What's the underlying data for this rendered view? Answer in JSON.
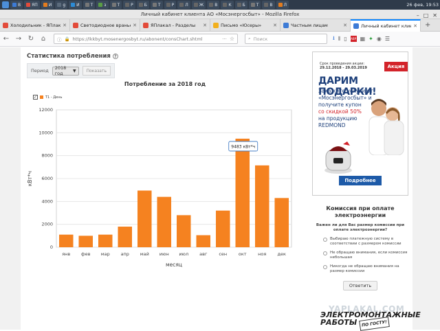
{
  "desktop": {
    "clock": "26 фев, 19:53",
    "tasks": [
      {
        "label": "В",
        "color": "#3d7bd6"
      },
      {
        "label": "ЯП",
        "color": "#e34b3a"
      },
      {
        "label": "И",
        "color": "#e37c1e"
      },
      {
        "label": "g",
        "color": "#5b6b7c"
      },
      {
        "label": "И",
        "color": "#2c8bd6"
      },
      {
        "label": "Т",
        "color": "#777777"
      },
      {
        "label": "з",
        "color": "#5a9d44"
      },
      {
        "label": "Т",
        "color": "#777777"
      },
      {
        "label": "Р",
        "color": "#666666"
      },
      {
        "label": "Б",
        "color": "#666666"
      },
      {
        "label": "Т",
        "color": "#777777"
      },
      {
        "label": "Р",
        "color": "#666666"
      },
      {
        "label": "Л",
        "color": "#666666"
      },
      {
        "label": "Ж",
        "color": "#666666"
      },
      {
        "label": "В",
        "color": "#666666"
      },
      {
        "label": "К",
        "color": "#666666"
      },
      {
        "label": "Б",
        "color": "#666666"
      },
      {
        "label": "Т",
        "color": "#777777"
      },
      {
        "label": "В",
        "color": "#666666"
      },
      {
        "label": "Л",
        "color": "#e37c1e"
      }
    ]
  },
  "window": {
    "title": "Личный кабинет клиента АО «Мосэнергосбыт» - Mozilla Firefox"
  },
  "tabs": [
    {
      "label": "Холодильник - ЯПлакал",
      "color": "#e34b3a",
      "active": false
    },
    {
      "label": "Светодиодное вранье",
      "color": "#e34b3a",
      "active": false
    },
    {
      "label": "ЯПлакал - Разделы",
      "color": "#e34b3a",
      "active": false
    },
    {
      "label": "Письмо «Юсеры»",
      "color": "#f2b01e",
      "active": false
    },
    {
      "label": "Частным лицам",
      "color": "#3d7bd6",
      "active": false
    },
    {
      "label": "Личный кабинет клиента",
      "color": "#3d7bd6",
      "active": true
    }
  ],
  "nav": {
    "url": "https://lkkbyt.mosenergosbyt.ru/abonent/consChart.shtml",
    "search_placeholder": "Поиск"
  },
  "page": {
    "stat_title": "Статистика потребления",
    "period_label": "Период",
    "year": "2018 год",
    "show_button": "Показать"
  },
  "sidebar": {
    "promo": {
      "dates_label": "Срок проведения акции:",
      "dates": "29.12.2018 - 29.03.2019",
      "badge": "Акция",
      "heading": "ДАРИМ ПОДАРКИ!",
      "line1": "Закажите услуги от «Мосэнергосбыт» и получите купон",
      "line2": "со скидкой 50%",
      "line3": "на продукцию REDMOND",
      "more": "Подробнее"
    },
    "fee": {
      "heading": "Комиссия при оплате электроэнергии",
      "question": "Важен ли для Вас размер комиссии при оплате электроэнергии?",
      "options": [
        "Выбираю платежную систему в соответствии с размером комиссии",
        "Не обращаю внимания, если комиссия небольшая",
        "Никогда не обращаю внимания на размер комиссии"
      ],
      "answer": "Ответить"
    },
    "watermark": "YAPLAKAL.COM",
    "ad2": "ЭЛЕКТРОМОНТАЖНЫЕ РАБОТЫ",
    "ad2_stamp": "ПО ГОСТУ!"
  },
  "chart_data": {
    "type": "bar",
    "title": "Потребление за 2018 год",
    "xlabel": "месяц",
    "ylabel": "кВт*ч",
    "ylim": [
      0,
      12000
    ],
    "yticks": [
      0,
      2000,
      4000,
      6000,
      8000,
      10000,
      12000
    ],
    "grid": true,
    "legend": "Т1 - День",
    "bar_color": "#f58220",
    "categories": [
      "янв",
      "фев",
      "мар",
      "апр",
      "май",
      "июн",
      "июл",
      "авг",
      "сен",
      "окт",
      "ноя",
      "дек"
    ],
    "values": [
      1100,
      1000,
      1100,
      1800,
      4950,
      4400,
      2800,
      1050,
      3200,
      9483,
      7150,
      4300
    ],
    "tooltip": {
      "index": 9,
      "text": "9483 кВт*ч"
    }
  }
}
